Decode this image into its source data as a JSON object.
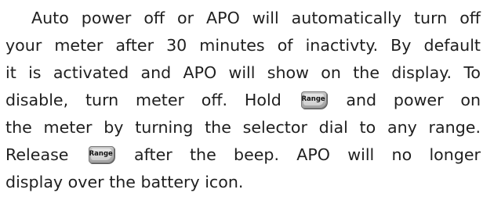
{
  "document": {
    "lines": [
      "Auto power off or APO will automatically turn off",
      "your meter after 30 minutes of inactivty. By default",
      "it is activated and APO will show on the display. To",
      "disable, turn meter off. Hold",
      "and power on",
      "the meter by turning the selector dial to any range.",
      "Release",
      "after the beep. APO will no longer",
      "display over the battery icon."
    ],
    "button_label": "Range"
  }
}
